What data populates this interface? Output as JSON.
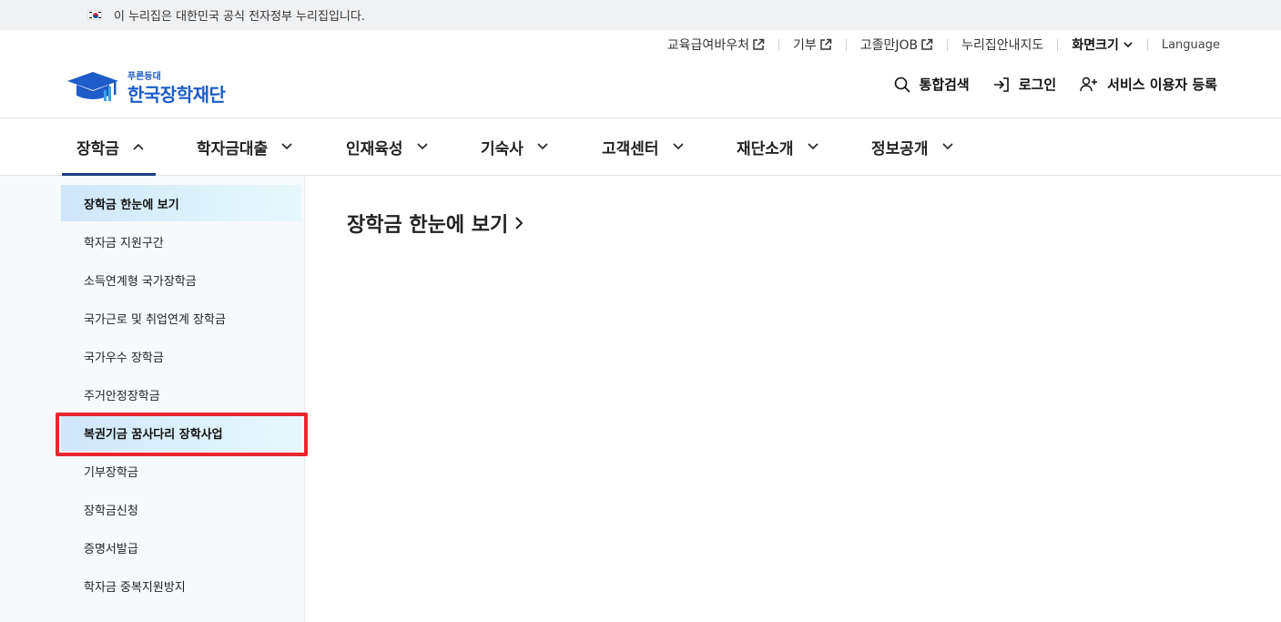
{
  "gov_banner": {
    "text": "이 누리집은 대한민국 공식 전자정부 누리집입니다."
  },
  "utility": {
    "voucher": "교육급여바우처",
    "donate": "기부",
    "job": "고졸만JOB",
    "sitemap": "누리집안내지도",
    "font_size": "화면크기",
    "language": "Language"
  },
  "logo": {
    "small": "푸른등대",
    "name": "한국장학재단"
  },
  "actions": {
    "search": "통합검색",
    "login": "로그인",
    "register": "서비스 이용자 등록"
  },
  "gnb": {
    "items": [
      "장학금",
      "학자금대출",
      "인재육성",
      "기숙사",
      "고객센터",
      "재단소개",
      "정보공개"
    ]
  },
  "side": {
    "items": [
      "장학금 한눈에 보기",
      "학자금 지원구간",
      "소득연계형 국가장학금",
      "국가근로 및 취업연계 장학금",
      "국가우수 장학금",
      "주거안정장학금",
      "복권기금 꿈사다리 장학사업",
      "기부장학금",
      "장학금신청",
      "증명서발급",
      "학자금 중복지원방지"
    ]
  },
  "main": {
    "title": "장학금 한눈에 보기"
  },
  "colors": {
    "brand": "#1e5cc8",
    "nav_underline": "#1c3f80",
    "highlight_box": "#e8272f"
  }
}
